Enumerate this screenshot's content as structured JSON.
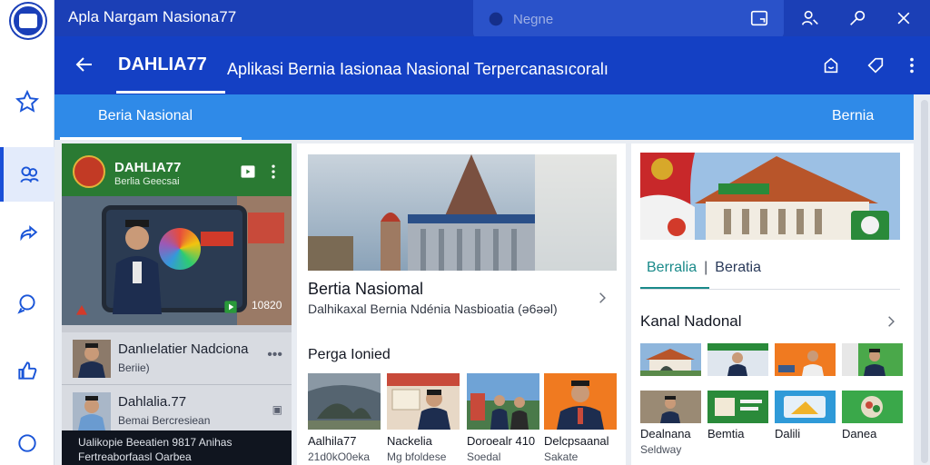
{
  "window": {
    "title": "Apla Nargam Nasiona77",
    "search_placeholder": "Negne"
  },
  "header": {
    "brand": "DAHLIA77",
    "subtitle": "Aplikasi Bernia Iasionaa Nasional Terpercanasıcoralı"
  },
  "tabs": {
    "left": "Beria Nasional",
    "right": "Bernia"
  },
  "featured": {
    "channel_title": "DAHLIA77",
    "channel_subtitle": "Berlia Geecsai",
    "video_time": "10820",
    "list": [
      {
        "title": "Danlıelatier Nadciona",
        "subtitle": "Beriie)"
      },
      {
        "title": "Dahlalia.77",
        "subtitle": "Bemai Bercresiean"
      }
    ],
    "footer_lines": [
      "Ualikopie Beeatien    9817  Anihas",
      "Fertreaborfaasl    Oarbea"
    ]
  },
  "main": {
    "title": "Bertia Nasiomal",
    "subtitle": "Dalhikaxal Bernia Ndénia Nasbioatia (ə6əəl)",
    "section": "Perga Ionied",
    "cards": [
      {
        "title": "Aalhila77",
        "subtitle": "21d0kO0eka"
      },
      {
        "title": "Nackelia",
        "subtitle": "Mg bfoldese"
      },
      {
        "title": "Doroealr 410",
        "subtitle": "Soedal"
      },
      {
        "title": "Delcpsaanal",
        "subtitle": "Sakate"
      }
    ]
  },
  "right_panel": {
    "tab_a": "Berralia",
    "tab_b": "Beratia",
    "section": "Kanal Nadonal",
    "captions": [
      {
        "title": "Dealnana",
        "subtitle": "Seldway"
      },
      {
        "title": "Bemtia",
        "subtitle": ""
      },
      {
        "title": "Dalili",
        "subtitle": ""
      },
      {
        "title": "Danea",
        "subtitle": ""
      }
    ]
  },
  "colors": {
    "titlebar": "#1b3fb6",
    "header": "#1440c4",
    "tabstrip": "#2f8ae8",
    "channel_header": "#2a7a33",
    "accent_teal": "#1a8a8a"
  },
  "icons": {
    "rail": [
      "star-icon",
      "people-icon",
      "share-icon",
      "chat-icon",
      "thumbs-up-icon",
      "message-icon"
    ],
    "titlebar": [
      "window-icon",
      "user-search-icon",
      "pin-icon",
      "close-icon"
    ],
    "header": [
      "back-icon",
      "notification-icon",
      "bookmark-icon",
      "more-icon"
    ]
  }
}
